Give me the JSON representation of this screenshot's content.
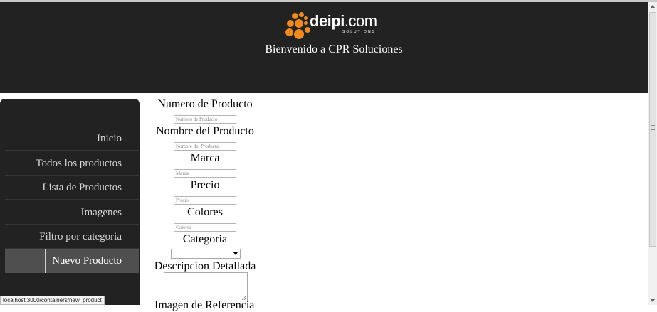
{
  "header": {
    "logo_brand": "deipi",
    "logo_suffix": ".com",
    "logo_tagline": "SOLUTIONS",
    "welcome": "Bienvenido a CPR Soluciones",
    "brand_color": "#f08a1c"
  },
  "sidebar": {
    "items": [
      {
        "label": "Inicio"
      },
      {
        "label": "Todos los productos"
      },
      {
        "label": "Lista de Productos"
      },
      {
        "label": "Imagenes"
      },
      {
        "label": "Filtro por categoria"
      },
      {
        "label": "Nuevo Producto",
        "active": true
      }
    ]
  },
  "form": {
    "numero_label": "Numero de Producto",
    "numero_placeholder": "Numero de Producto",
    "nombre_label": "Nombre del Producto",
    "nombre_placeholder": "Nombre del Producto",
    "marca_label": "Marca",
    "marca_placeholder": "Marca",
    "precio_label": "Precio",
    "precio_placeholder": "Precio",
    "colores_label": "Colores",
    "colores_placeholder": "Colores",
    "categoria_label": "Categoria",
    "categoria_value": "",
    "descripcion_label": "Descripcion Detallada",
    "next_label_partial": "Imagen de Referencia"
  },
  "status_bar": {
    "url": "localhost:3000/containers/new_product"
  }
}
